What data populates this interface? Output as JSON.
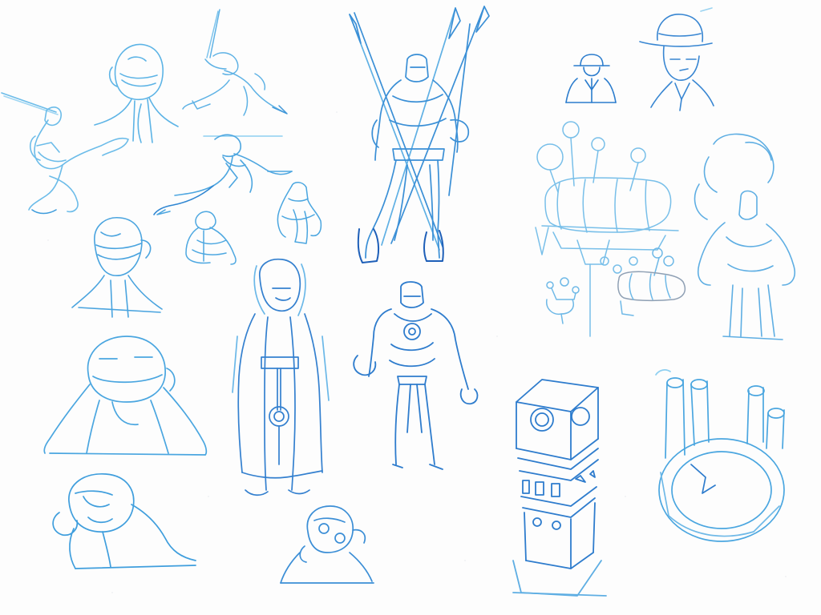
{
  "sheet": {
    "kind": "pencil-sketch-sheet",
    "medium": "blue-pencil",
    "colors": {
      "paper": "#fdfdfd",
      "pencil_light": "#8ecff0",
      "pencil_mid": "#4aa8e2",
      "pencil_dark": "#1f6fc4",
      "pencil_gray": "#7d8fa3"
    },
    "figures": [
      {
        "id": "leaping-swordsman",
        "icon": "leaping-swordsman-sketch"
      },
      {
        "id": "hooded-head-bust",
        "icon": "hooded-head-sketch"
      },
      {
        "id": "running-swordsman",
        "icon": "running-swordsman-sketch"
      },
      {
        "id": "flying-kick-figure",
        "icon": "flying-kick-sketch"
      },
      {
        "id": "small-crouching-figure",
        "icon": "crouching-figure-sketch"
      },
      {
        "id": "armored-torso",
        "icon": "armored-torso-sketch"
      },
      {
        "id": "spearman-warrior",
        "icon": "spearman-sketch"
      },
      {
        "id": "fedora-man-small",
        "icon": "fedora-silhouette-sketch"
      },
      {
        "id": "fedora-man-bust",
        "icon": "fedora-bust-sketch"
      },
      {
        "id": "bald-masked-bust",
        "icon": "masked-bust-sketch"
      },
      {
        "id": "long-coat-figure",
        "icon": "long-coat-figure-sketch"
      },
      {
        "id": "armored-hero",
        "icon": "armored-hero-sketch"
      },
      {
        "id": "airship-with-balloons",
        "icon": "airship-sketch"
      },
      {
        "id": "scrap-vehicle",
        "icon": "vehicle-sketch"
      },
      {
        "id": "coiled-hair-figure",
        "icon": "coiled-hair-figure-sketch"
      },
      {
        "id": "hooded-heavy-bust",
        "icon": "heavy-hooded-bust-sketch"
      },
      {
        "id": "bulky-crouching-head",
        "icon": "bulky-head-sketch"
      },
      {
        "id": "small-round-head",
        "icon": "round-head-sketch"
      },
      {
        "id": "clock-tower",
        "icon": "clock-tower-sketch"
      },
      {
        "id": "ring-with-pipes",
        "icon": "ring-pipes-sketch"
      }
    ]
  }
}
